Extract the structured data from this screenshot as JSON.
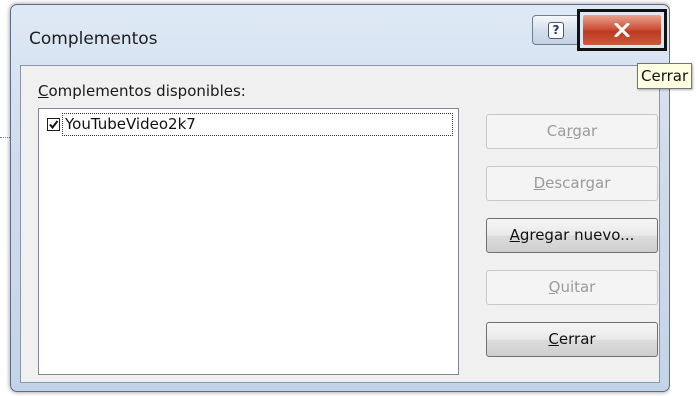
{
  "window": {
    "title": "Complementos",
    "help_label": "?"
  },
  "list": {
    "label": "Complementos disponibles:",
    "items": [
      {
        "label": "YouTubeVideo2k7",
        "checked": true
      }
    ]
  },
  "buttons": {
    "load": {
      "pre": "Ca",
      "key": "r",
      "post": "gar"
    },
    "unload": {
      "pre": "",
      "key": "D",
      "post": "escargar"
    },
    "add_new": {
      "pre": "",
      "key": "A",
      "post": "gregar nuevo..."
    },
    "remove": {
      "pre": "",
      "key": "Q",
      "post": "uitar"
    },
    "close": {
      "pre": "",
      "key": "C",
      "post": "errar"
    }
  },
  "tooltip": {
    "text": "Cerrar"
  }
}
